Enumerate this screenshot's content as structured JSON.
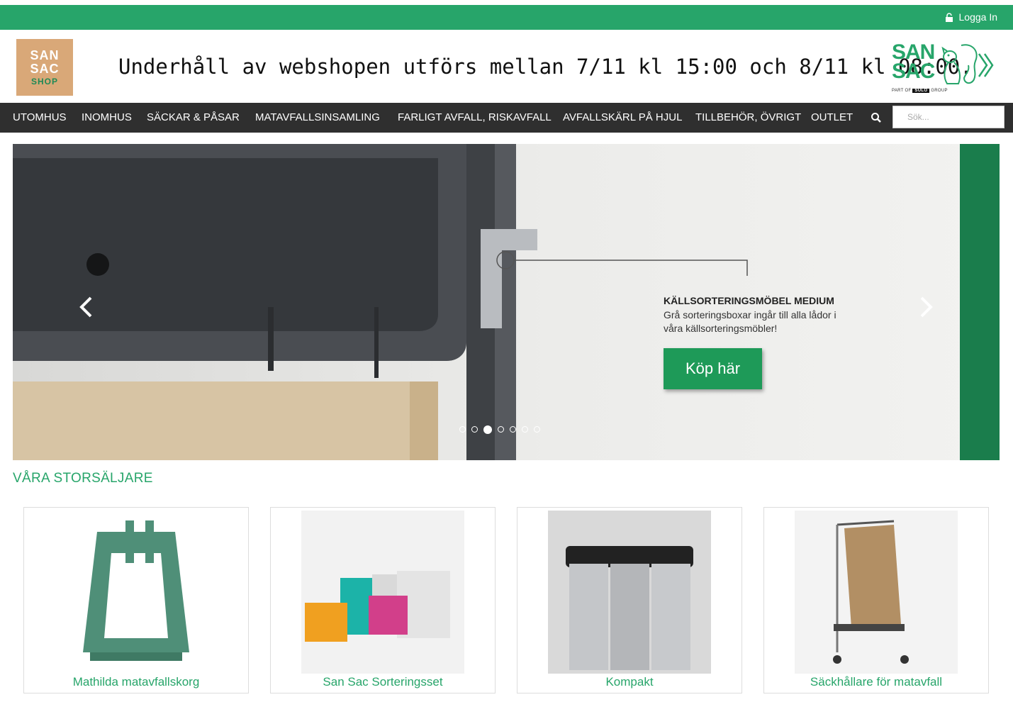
{
  "topbar": {
    "login_label": "Logga In",
    "login_icon": "lock-icon"
  },
  "header": {
    "shop_logo": {
      "line1": "SAN",
      "line2": "SAC",
      "line3": "SHOP"
    },
    "notice": "Underhåll av webshopen utförs mellan 7/11 kl 15:00 och 8/11 kl 08:00.",
    "brand": {
      "line1": "SAN",
      "line2": "SAC",
      "part_of": "PART OF",
      "group_brand": "SULO",
      "group": "GROUP"
    }
  },
  "nav": {
    "items": [
      "UTOMHUS",
      "INOMHUS",
      "SÄCKAR & PÅSAR",
      "MATAVFALLSINSAMLING",
      "FARLIGT AVFALL, RISKAVFALL",
      "AVFALLSKÄRL PÅ HJUL",
      "TILLBEHÖR, ÖVRIGT",
      "OUTLET"
    ],
    "search_placeholder": "Sök..."
  },
  "hero": {
    "title": "KÄLLSORTERINGSMÖBEL MEDIUM",
    "text": "Grå sorteringsboxar ingår till alla lådor i våra källsorteringsmöbler!",
    "cta": "Köp här",
    "slide_count": 7,
    "active_slide": 3
  },
  "bestsellers": {
    "title": "VÅRA STORSÄLJARE",
    "products": [
      {
        "name": "Mathilda matavfallskorg"
      },
      {
        "name": "San Sac Sorteringsset"
      },
      {
        "name": "Kompakt"
      },
      {
        "name": "Säckhållare för matavfall"
      }
    ]
  },
  "colors": {
    "brand_green": "#27a56a",
    "nav_bg": "#2f2f2f",
    "cta_green": "#1e9a58"
  }
}
